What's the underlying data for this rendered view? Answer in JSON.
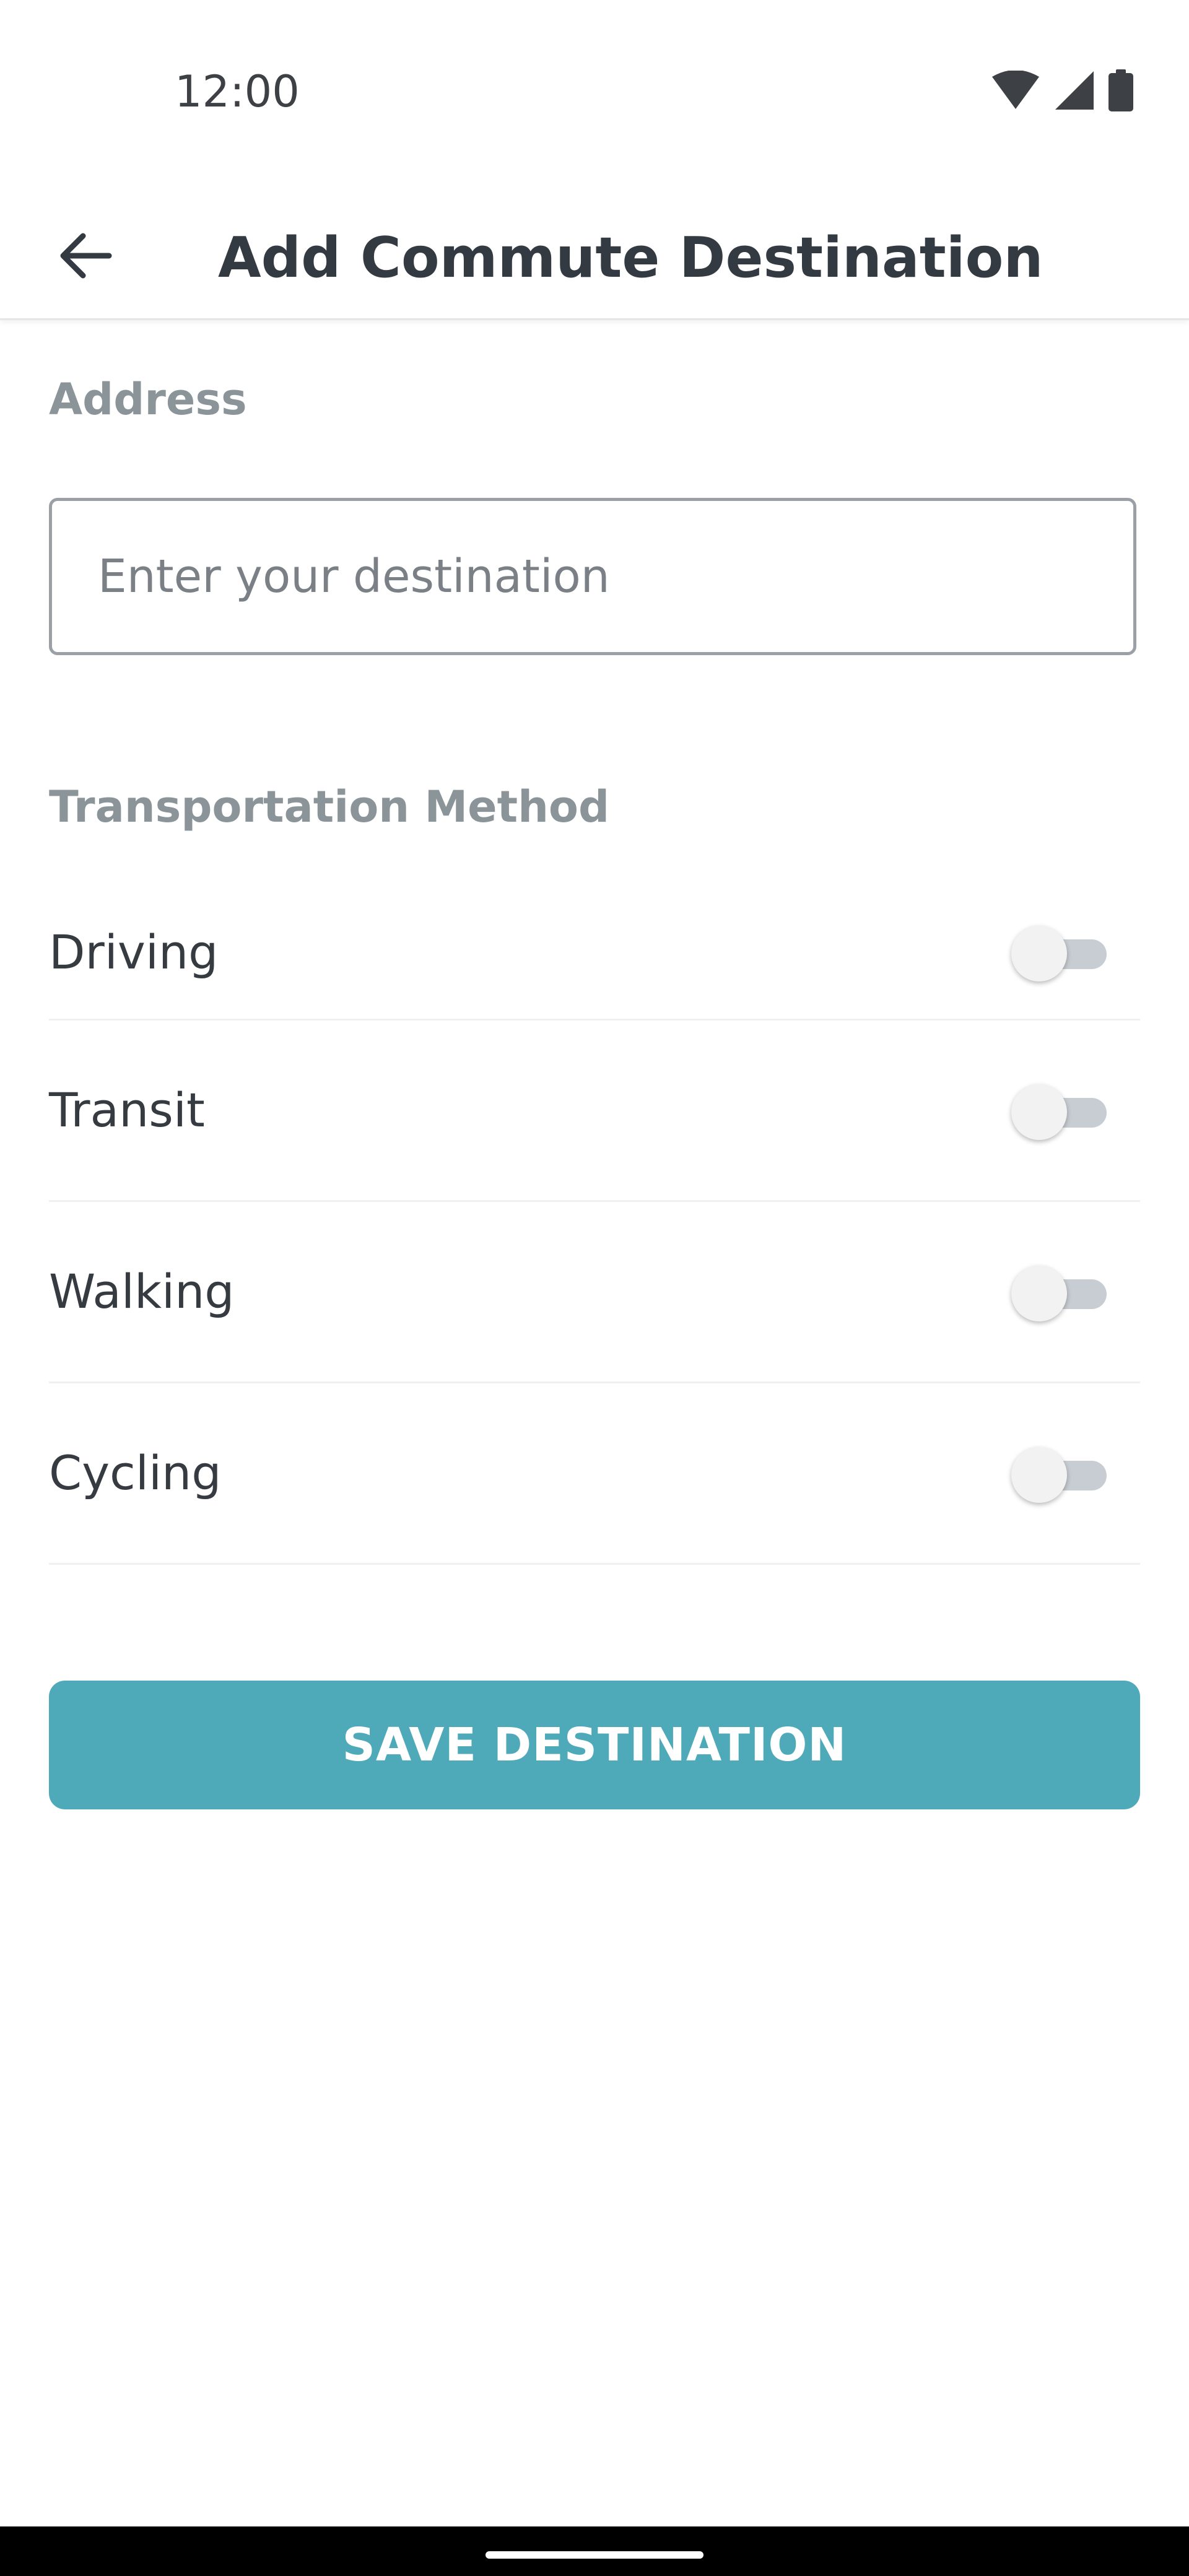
{
  "status_bar": {
    "time": "12:00",
    "icons": [
      "wifi-icon",
      "cellular-signal-icon",
      "battery-icon"
    ]
  },
  "app_bar": {
    "title": "Add Commute Destination",
    "back_icon": "arrow-left-icon"
  },
  "address": {
    "label": "Address",
    "value": "",
    "placeholder": "Enter your destination"
  },
  "transportation": {
    "label": "Transportation Method",
    "options": [
      {
        "label": "Driving",
        "enabled": false
      },
      {
        "label": "Transit",
        "enabled": false
      },
      {
        "label": "Walking",
        "enabled": false
      },
      {
        "label": "Cycling",
        "enabled": false
      }
    ]
  },
  "save_button": {
    "label": "SAVE DESTINATION"
  },
  "colors": {
    "accent": "#4eaab8",
    "section_label": "#8b9499",
    "text": "#333a42",
    "toggle_track_off": "#c7cdd2",
    "toggle_thumb_off": "#f2f2f2"
  }
}
